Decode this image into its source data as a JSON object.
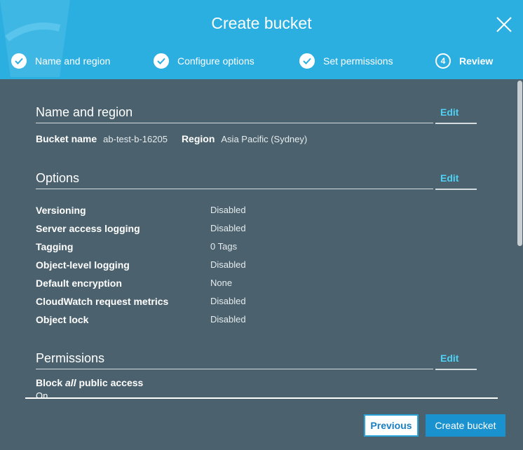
{
  "header": {
    "title": "Create bucket",
    "steps": [
      {
        "label": "Name and region",
        "state": "done"
      },
      {
        "label": "Configure options",
        "state": "done"
      },
      {
        "label": "Set permissions",
        "state": "done"
      },
      {
        "label": "Review",
        "number": "4",
        "state": "current"
      }
    ],
    "close_icon": "close-icon"
  },
  "name_region": {
    "title": "Name and region",
    "edit": "Edit",
    "bucket_name_label": "Bucket name",
    "bucket_name_value": "ab-test-b-16205",
    "region_label": "Region",
    "region_value": "Asia Pacific (Sydney)"
  },
  "options": {
    "title": "Options",
    "edit": "Edit",
    "rows": [
      {
        "label": "Versioning",
        "value": "Disabled"
      },
      {
        "label": "Server access logging",
        "value": "Disabled"
      },
      {
        "label": "Tagging",
        "value": "0 Tags"
      },
      {
        "label": "Object-level logging",
        "value": "Disabled"
      },
      {
        "label": "Default encryption",
        "value": "None"
      },
      {
        "label": "CloudWatch request metrics",
        "value": "Disabled"
      },
      {
        "label": "Object lock",
        "value": "Disabled"
      }
    ]
  },
  "permissions": {
    "title": "Permissions",
    "edit": "Edit",
    "block_label_pre": "Block ",
    "block_label_em": "all",
    "block_label_post": " public access",
    "block_value": "On"
  },
  "footer": {
    "previous": "Previous",
    "create": "Create bucket"
  },
  "colors": {
    "header_bg": "#2baee0",
    "body_bg": "#4b626e",
    "edit_link": "#4fd1f5",
    "primary_button": "#1a92d0"
  }
}
